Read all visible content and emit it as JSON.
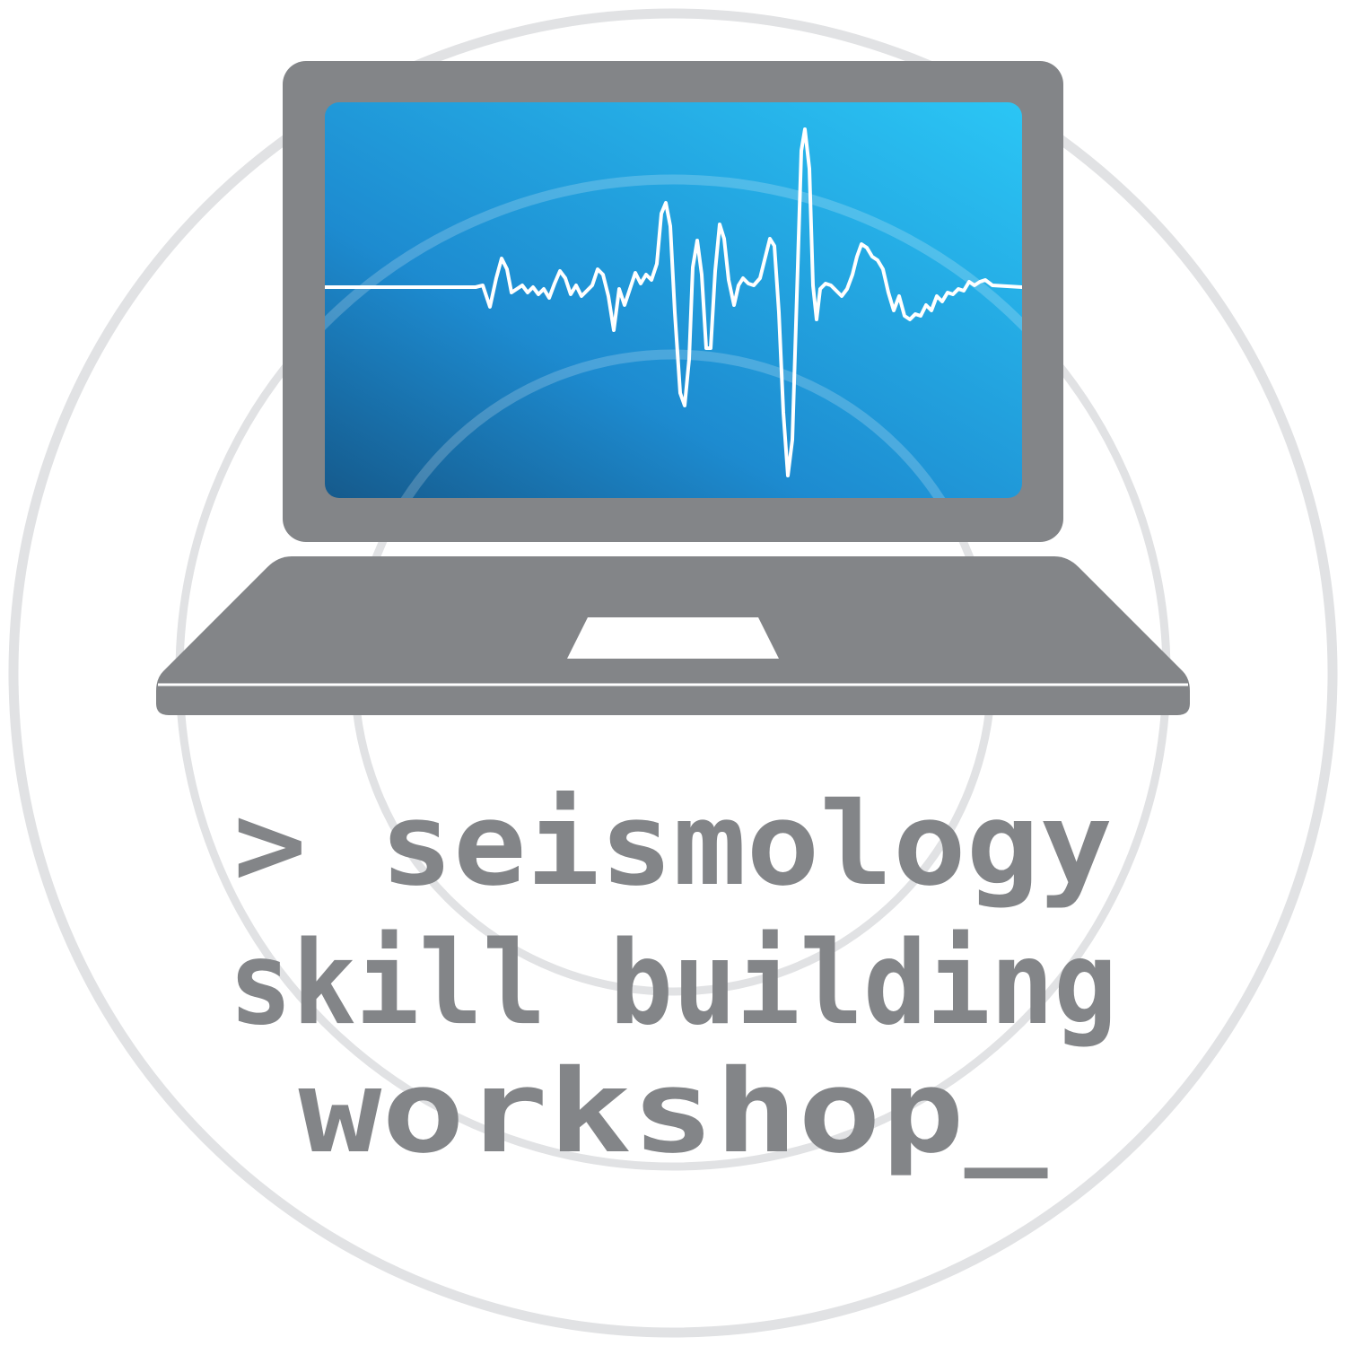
{
  "logo": {
    "title_lines": [
      "> seismology",
      "skill building",
      "workshop_"
    ],
    "icons": {
      "laptop": "laptop-icon",
      "seismogram": "seismogram-waveform-icon",
      "touchpad": "touchpad-icon"
    },
    "colors": {
      "text_gray": "#838588",
      "laptop_gray": "#838588",
      "ring_gray": "#e1e2e4",
      "screen_blue_dark": "#155a8c",
      "screen_blue_mid": "#1d8bd0",
      "screen_blue_light": "#2bc6f5",
      "trace_white": "#ffffff"
    }
  }
}
